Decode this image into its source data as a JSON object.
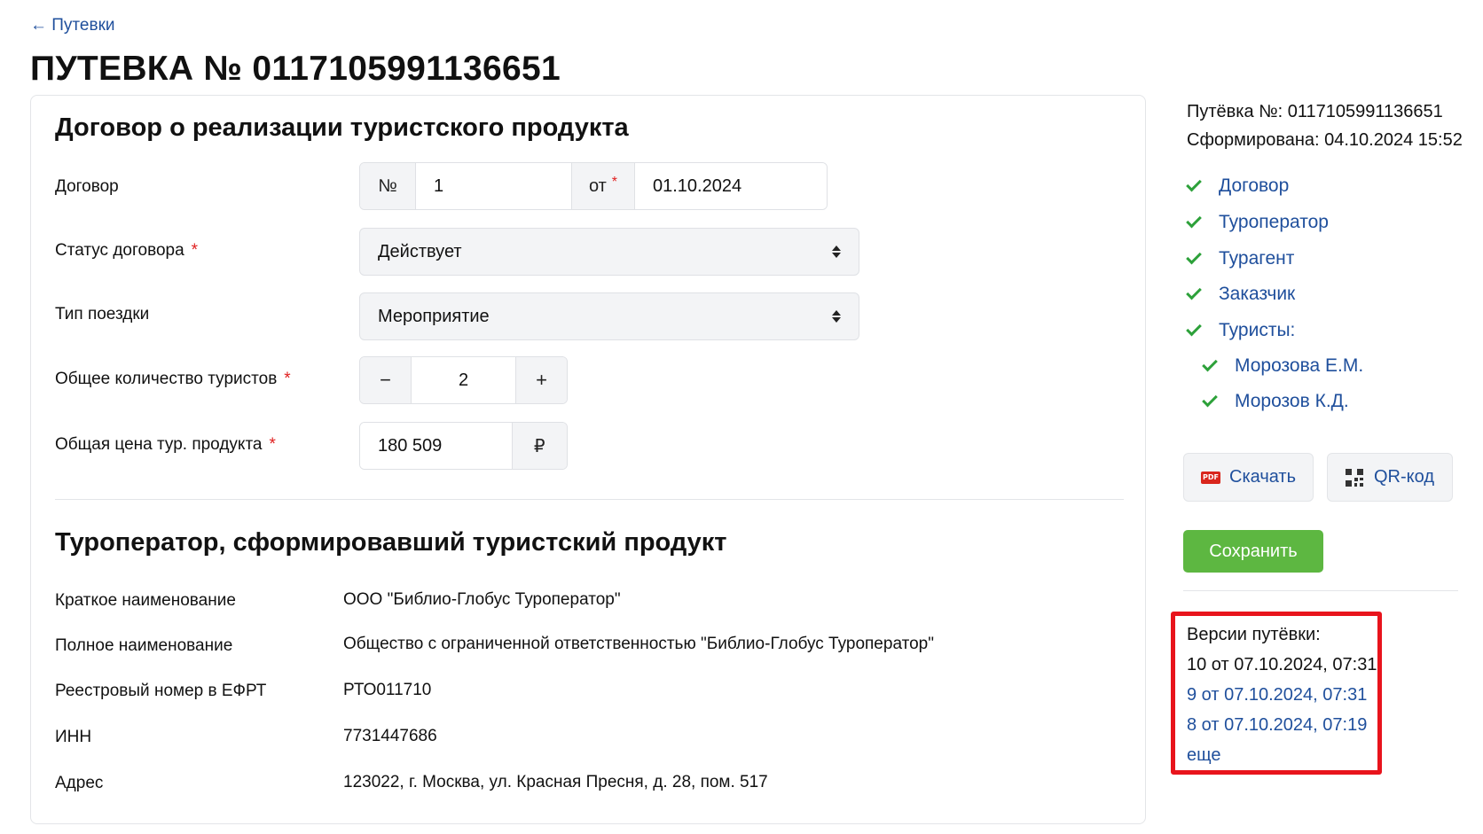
{
  "nav": {
    "back_label": "← Путевки"
  },
  "page": {
    "title": "ПУТЕВКА № 0117105991136651"
  },
  "contract_section": {
    "title": "Договор о реализации туристского продукта",
    "contract": {
      "label": "Договор",
      "number_prefix": "№",
      "number": "1",
      "date_prefix": "от",
      "date_required_mark": "*",
      "date": "01.10.2024"
    },
    "status": {
      "label": "Статус договора",
      "required_mark": "*",
      "value": "Действует"
    },
    "trip_type": {
      "label": "Тип поездки",
      "value": "Мероприятие"
    },
    "tourists_count": {
      "label": "Общее количество туристов",
      "required_mark": "*",
      "minus": "−",
      "value": "2",
      "plus": "+"
    },
    "total_price": {
      "label": "Общая цена тур. продукта",
      "required_mark": "*",
      "value": "180 509",
      "currency": "₽"
    }
  },
  "operator_section": {
    "title": "Туроператор, сформировавший туристский продукт",
    "rows": [
      {
        "label": "Краткое наименование",
        "value": "ООО \"Библио-Глобус Туроператор\""
      },
      {
        "label": "Полное наименование",
        "value": "Общество с ограниченной ответственностью \"Библио-Глобус Туроператор\""
      },
      {
        "label": "Реестровый номер в ЕФРТ",
        "value": "РТО011710"
      },
      {
        "label": "ИНН",
        "value": "7731447686"
      },
      {
        "label": "Адрес",
        "value": "123022, г. Москва, ул. Красная Пресня, д. 28, пом. 517"
      }
    ]
  },
  "sidebar": {
    "voucher_number": "Путёвка №: 0117105991136651",
    "created": "Сформирована: 04.10.2024 15:52",
    "checklist": [
      {
        "label": "Договор"
      },
      {
        "label": "Туроператор"
      },
      {
        "label": "Турагент"
      },
      {
        "label": "Заказчик"
      },
      {
        "label": "Туристы:"
      },
      {
        "label": "Морозова Е.М."
      },
      {
        "label": "Морозов К.Д."
      }
    ],
    "download_label": "Скачать",
    "pdf_badge": "PDF",
    "qr_label": "QR-код",
    "save_label": "Сохранить",
    "versions": {
      "title": "Версии путёвки:",
      "current": "10 от 07.10.2024, 07:31",
      "links": [
        "9 от 07.10.2024, 07:31",
        "8 от 07.10.2024, 07:19"
      ],
      "more": "еще"
    }
  },
  "colors": {
    "link": "#1f4f9c",
    "check": "#2da13a",
    "save_button": "#5db741",
    "required": "#e02020",
    "highlight_box": "#e8141c"
  }
}
